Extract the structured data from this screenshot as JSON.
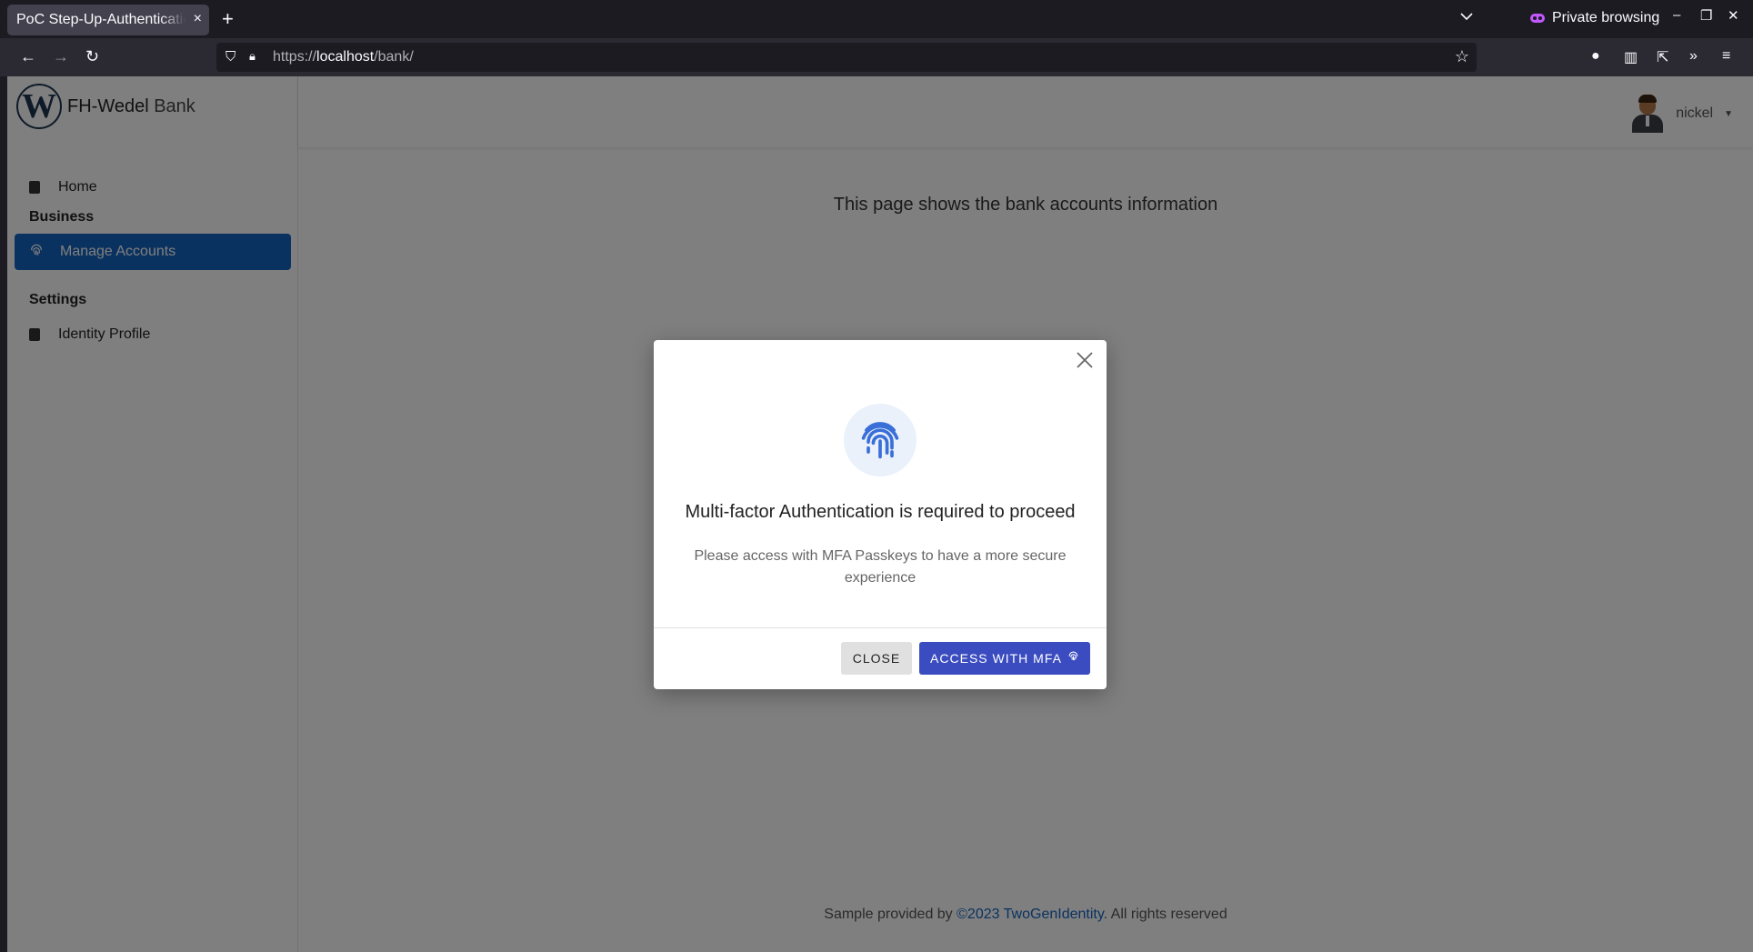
{
  "browser": {
    "tab_title": "PoC Step-Up-Authentication",
    "tab_close": "×",
    "new_tab": "+",
    "private_label": "Private browsing",
    "url_prefix": "https://",
    "url_host": "localhost",
    "url_path": "/bank/"
  },
  "sidebar": {
    "brand_bold": "FH-Wedel",
    "brand_light": "Bank",
    "logo_letter": "W",
    "home_label": "Home",
    "section_business": "Business",
    "manage_accounts_label": "Manage Accounts",
    "section_settings": "Settings",
    "identity_profile_label": "Identity Profile"
  },
  "topbar": {
    "username": "nickel"
  },
  "main": {
    "info_text": "This page shows the bank accounts information"
  },
  "footer": {
    "prefix": "Sample provided by ",
    "link": "©2023 TwoGenIdentity",
    "suffix": ". All rights reserved"
  },
  "modal": {
    "title": "Multi-factor Authentication is required to proceed",
    "body": "Please access with MFA Passkeys to have a more secure experience",
    "close_button": "CLOSE",
    "mfa_button": "ACCESS WITH MFA"
  },
  "colors": {
    "primary": "#1565c0",
    "mfa_button": "#3a4cc0",
    "fingerprint": "#3b6fd8"
  },
  "icons": [
    "fingerprint-icon",
    "close-icon",
    "home-icon",
    "identity-icon"
  ]
}
